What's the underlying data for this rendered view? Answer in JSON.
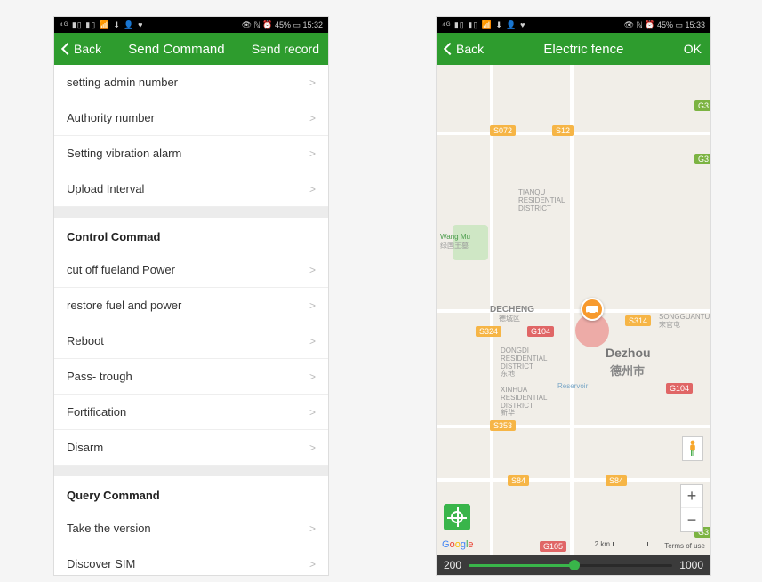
{
  "left": {
    "status": {
      "icons": "⁴ᴳ ▮▯ ▮▯ 📶 ⬇ 👤 ♥",
      "right": "👁 ℕ ⏰ 45% ▭ 15:32"
    },
    "header": {
      "back": "Back",
      "title": "Send Command",
      "action": "Send record"
    },
    "sections": [
      {
        "header": null,
        "rows": [
          "setting admin number",
          "Authority number",
          "Setting vibration alarm",
          "Upload Interval"
        ]
      },
      {
        "header": "Control Commad",
        "rows": [
          "cut off fueland Power",
          "restore fuel and power",
          "Reboot",
          "Pass- trough",
          "Fortification",
          "Disarm"
        ]
      },
      {
        "header": "Query Command",
        "rows": [
          "Take the version",
          "Discover SIM"
        ]
      }
    ],
    "chevron": ">"
  },
  "right": {
    "status": {
      "icons": "⁴ᴳ ▮▯ ▮▯ 📶 ⬇ 👤 ♥",
      "right": "👁 ℕ ⏰ 45% ▭ 15:33"
    },
    "header": {
      "back": "Back",
      "title": "Electric fence",
      "action": "OK"
    },
    "map": {
      "city_en": "Dezhou",
      "city_zh": "德州市",
      "decheng_en": "DECHENG",
      "decheng_zh": "德城区",
      "dongdi": "DONGDI\nRESIDENTIAL\nDISTRICT\n东地",
      "xinhua": "XINHUA\nRESIDENTIAL\nDISTRICT\n新华",
      "tianqu": "TIANQU\nRESIDENTIAL\nDISTRICT",
      "wangmu": "Wang Mu",
      "wangmu_zh": "绿国王墓",
      "reservoir": "Reservoir",
      "songguantun": "SONGGUANTUN\n宋官屯",
      "badges": {
        "s072": "S072",
        "s12": "S12",
        "g3a": "G3",
        "g3b": "G3",
        "s324": "S324",
        "g104a": "G104",
        "g104b": "G104",
        "s314": "S314",
        "s353": "S353",
        "s84a": "S84",
        "s84b": "S84",
        "g105": "G105",
        "g3c": "G3"
      },
      "google": [
        "G",
        "o",
        "o",
        "g",
        "l",
        "e"
      ],
      "scale": "2 km",
      "terms": "Terms of use"
    },
    "slider": {
      "min": "200",
      "max": "1000"
    }
  }
}
